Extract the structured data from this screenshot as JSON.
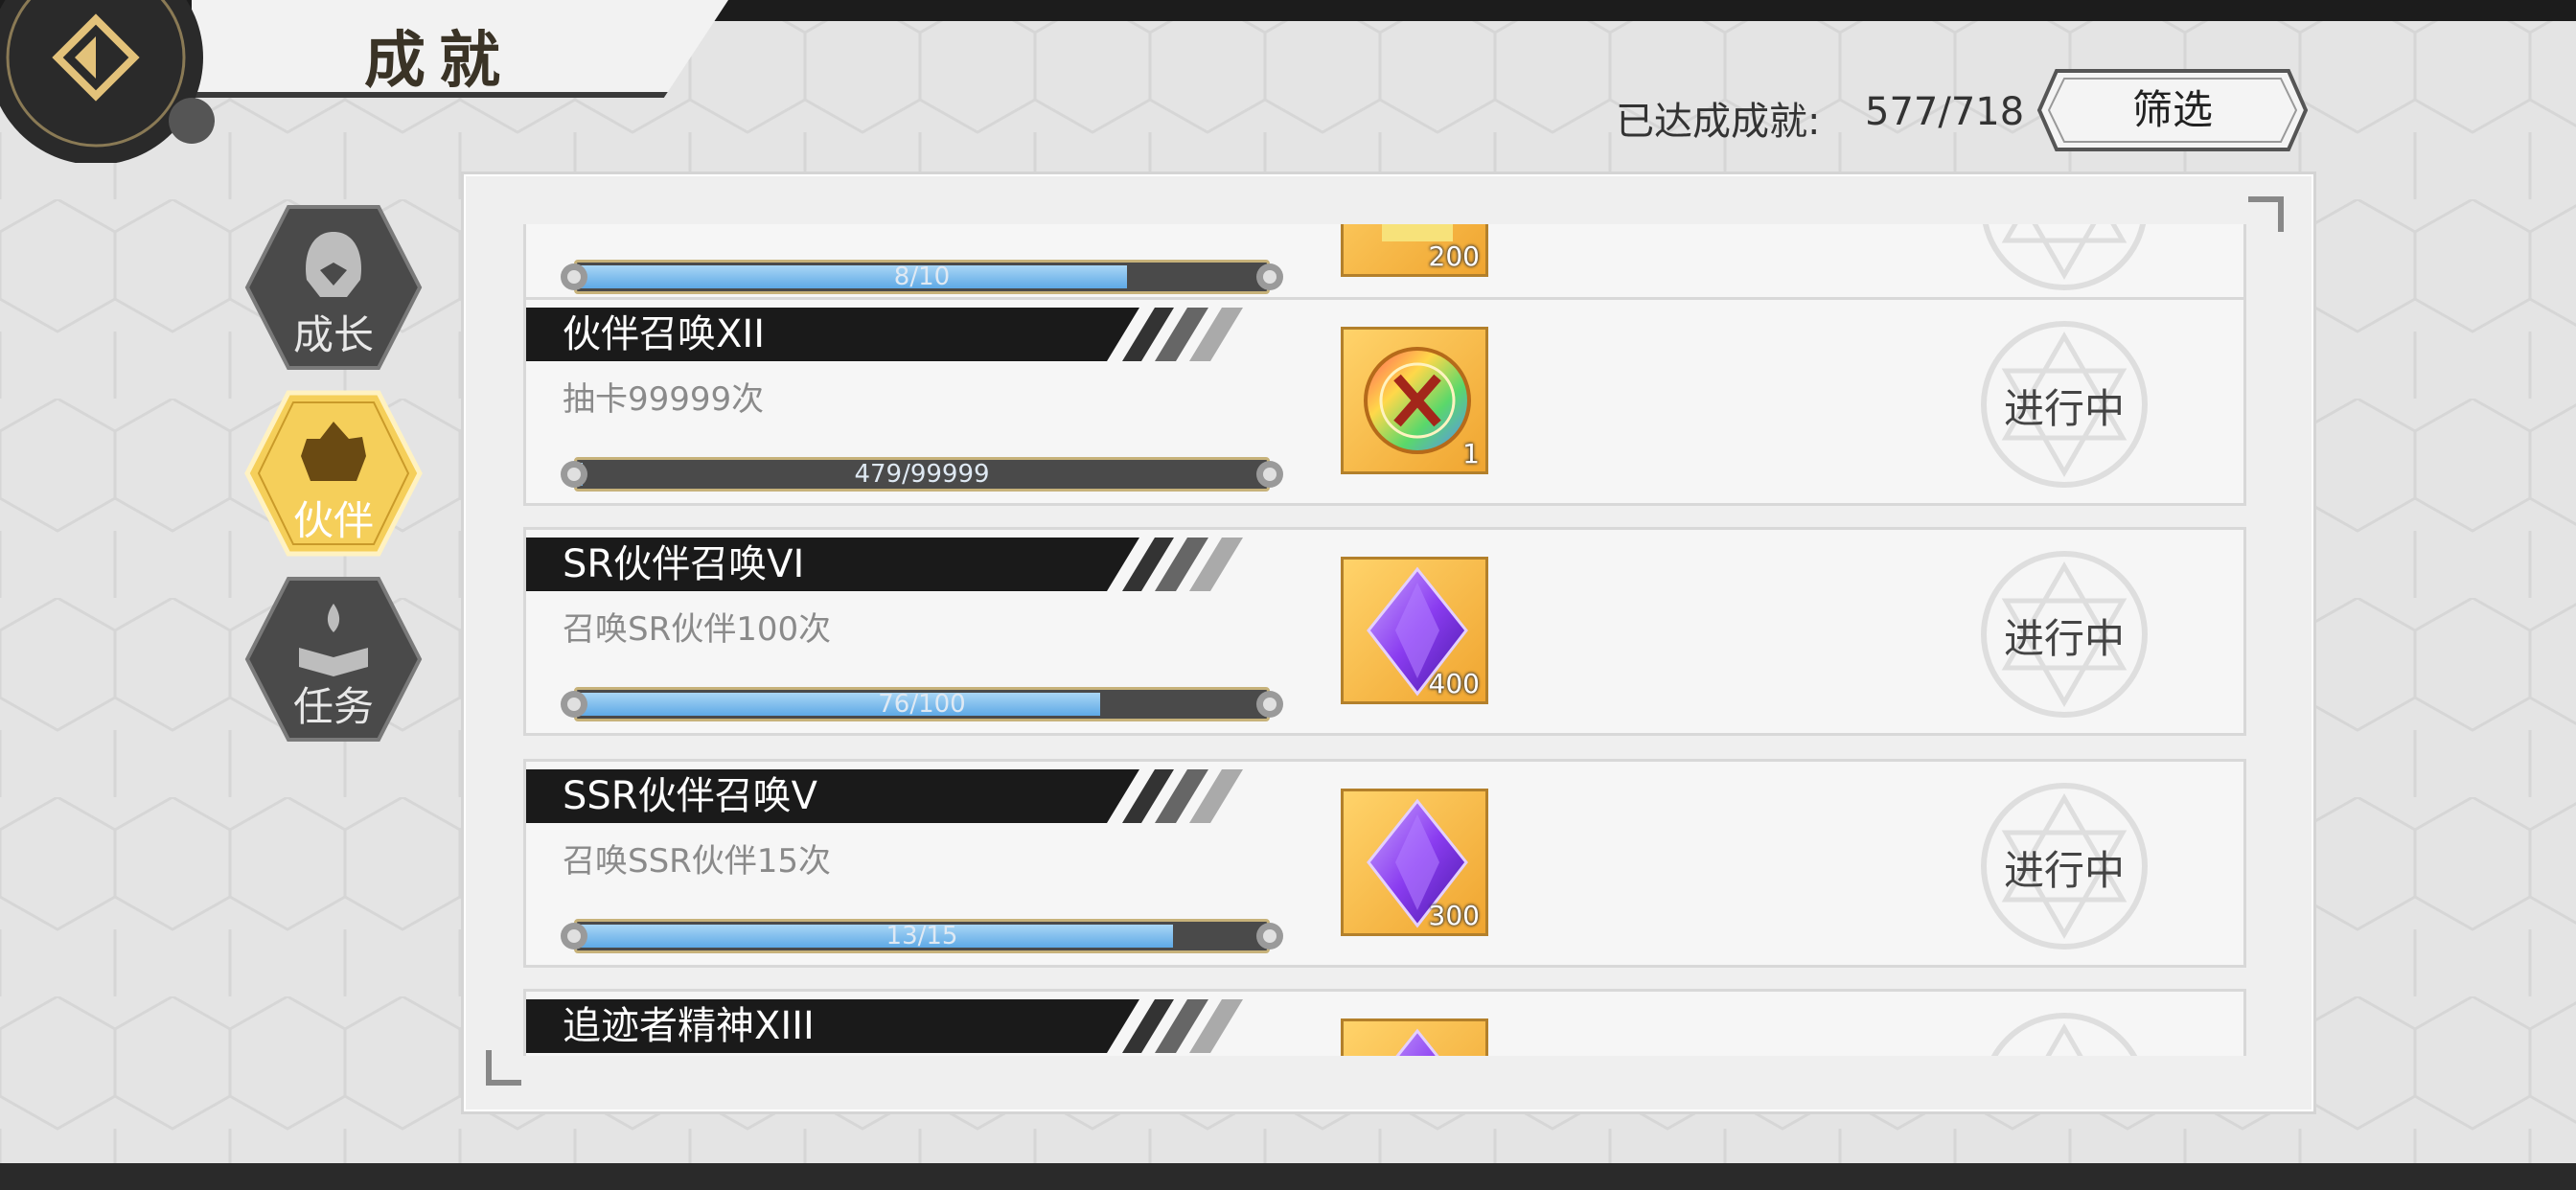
{
  "header": {
    "title": "成就",
    "achieved_label": "已达成成就:",
    "achieved_value": "577/718",
    "filter_label": "筛选"
  },
  "sidebar": {
    "tabs": [
      {
        "label": "成长",
        "active": false,
        "icon": "hooded-figure-icon"
      },
      {
        "label": "伙伴",
        "active": true,
        "icon": "party-group-icon"
      },
      {
        "label": "任务",
        "active": false,
        "icon": "open-book-flame-icon"
      }
    ]
  },
  "achievements": [
    {
      "title": "",
      "desc": "",
      "progress_text": "8/10",
      "progress": 0.8,
      "reward_icon": "gold-item-icon",
      "reward_qty": "200",
      "status": "",
      "partial": "top"
    },
    {
      "title": "伙伴召唤XII",
      "desc": "抽卡99999次",
      "progress_text": "479/99999",
      "progress": 0.0048,
      "reward_icon": "rainbow-x-coin-icon",
      "reward_qty": "1",
      "status": "进行中"
    },
    {
      "title": "SR伙伴召唤VI",
      "desc": "召唤SR伙伴100次",
      "progress_text": "76/100",
      "progress": 0.76,
      "reward_icon": "purple-crystal-icon",
      "reward_qty": "400",
      "status": "进行中"
    },
    {
      "title": "SSR伙伴召唤V",
      "desc": "召唤SSR伙伴15次",
      "progress_text": "13/15",
      "progress": 0.8667,
      "reward_icon": "purple-crystal-icon",
      "reward_qty": "300",
      "status": "进行中"
    },
    {
      "title": "追迹者精神XIII",
      "desc": "",
      "progress_text": "",
      "progress": 0,
      "reward_icon": "purple-crystal-icon",
      "reward_qty": "",
      "status": "",
      "partial": "bottom"
    }
  ],
  "colors": {
    "accent_gold": "#f0c24a",
    "progress_blue": "#5ea9e6",
    "title_bar": "#1a1a1a"
  }
}
